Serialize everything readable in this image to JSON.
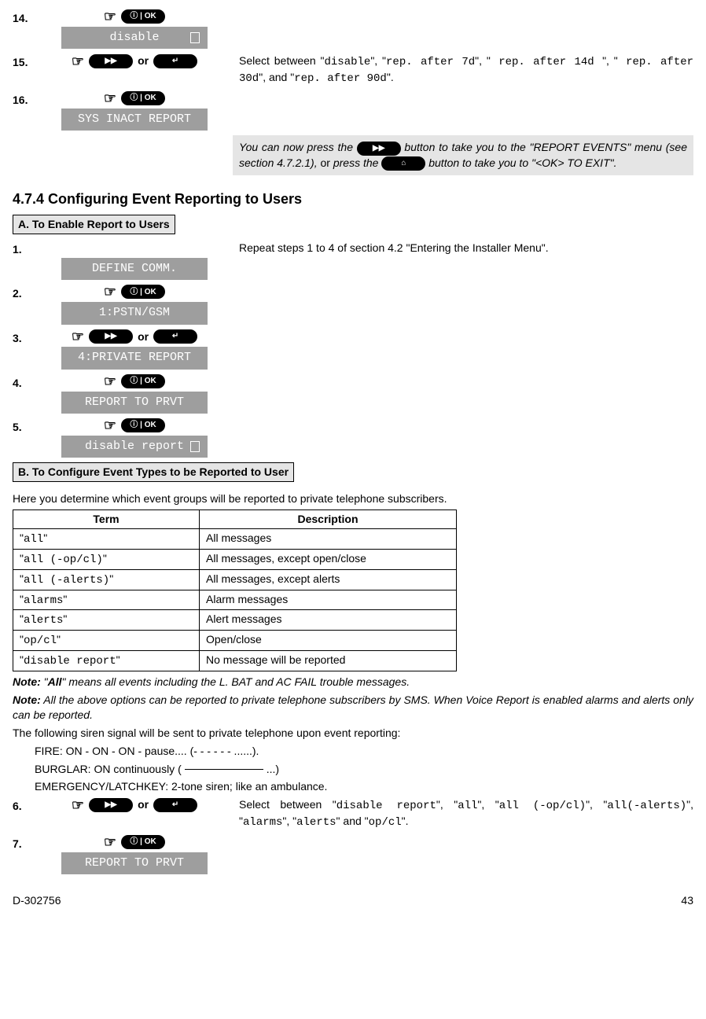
{
  "top_steps": {
    "s14": {
      "num": "14.",
      "lcd": "disable"
    },
    "s15": {
      "num": "15.",
      "or": "or",
      "desc_prefix": "Select between ",
      "opts": [
        "disable",
        "rep. after 7d",
        " rep. after 14d ",
        " rep. after 30d",
        "rep. after 90d"
      ],
      "sep": ", ",
      "and": ", and ",
      "period": "."
    },
    "s16": {
      "num": "16.",
      "lcd": "SYS INACT REPORT"
    }
  },
  "note_box": {
    "part1": "You can now press the  ",
    "part2": "  button to take you to the \"REPORT EVENTS\" menu (see section 4.7.2.1), ",
    "or": "or",
    "part3": " press the  ",
    "part4": "  button to take you to \"<OK>  TO  EXIT\"."
  },
  "section_title": "4.7.4 Configuring Event Reporting to Users",
  "sectA": {
    "header": "A. To Enable Report to Users",
    "s1": {
      "num": "1.",
      "lcd": "DEFINE COMM.",
      "desc": "Repeat steps 1 to 4 of section 4.2 \"Entering the Installer Menu\"."
    },
    "s2": {
      "num": "2.",
      "lcd": "1:PSTN/GSM"
    },
    "s3": {
      "num": "3.",
      "or": "or",
      "lcd": "4:PRIVATE REPORT"
    },
    "s4": {
      "num": "4.",
      "lcd": "REPORT TO PRVT"
    },
    "s5": {
      "num": "5.",
      "lcd": "disable report"
    }
  },
  "sectB": {
    "header": "B. To Configure Event Types to be Reported to User",
    "intro": "Here you determine which event groups will be reported to private telephone subscribers.",
    "th_term": "Term",
    "th_desc": "Description",
    "rows": [
      {
        "t": "all",
        "d": "All messages"
      },
      {
        "t": "all (-op/cl)",
        "d": "All messages, except open/close"
      },
      {
        "t": "all (-alerts)",
        "d": "All messages, except alerts"
      },
      {
        "t": "alarms",
        "d": "Alarm messages"
      },
      {
        "t": "alerts",
        "d": "Alert messages"
      },
      {
        "t": "op/cl",
        "d": "Open/close"
      },
      {
        "t": "disable report",
        "d": "No message will be reported"
      }
    ],
    "note1_label": "Note:",
    "note1_body_a": " \"",
    "note1_all": "All",
    "note1_body_b": "\" means all events including the L. BAT and AC FAIL trouble messages.",
    "note2_label": "Note:",
    "note2_body": " All the above options can be reported to private telephone subscribers by SMS. When Voice Report is enabled alarms and alerts only can be reported.",
    "siren_intro": "The following siren signal will be sent to private telephone upon event reporting:",
    "fire": "FIRE: ON - ON - ON - pause.... (- - - - - - ......).",
    "burglar_a": "BURGLAR: ON continuously (",
    "burglar_b": "...)",
    "emergency": "EMERGENCY/LATCHKEY: 2-tone siren; like an ambulance.",
    "s6": {
      "num": "6.",
      "or": "or",
      "desc_prefix": "Select between ",
      "opts": [
        "disable report",
        "all",
        "all (-op/cl)",
        "all(-alerts)",
        "alarms",
        "alerts",
        "op/cl"
      ],
      "and": " and ",
      "period": "."
    },
    "s7": {
      "num": "7.",
      "lcd": "REPORT TO PRVT"
    }
  },
  "footer": {
    "left": "D-302756",
    "right": "43"
  },
  "button_labels": {
    "ok": "ⓘ | OK",
    "ff": "▶▶",
    "back": "↵",
    "home": "⌂"
  }
}
